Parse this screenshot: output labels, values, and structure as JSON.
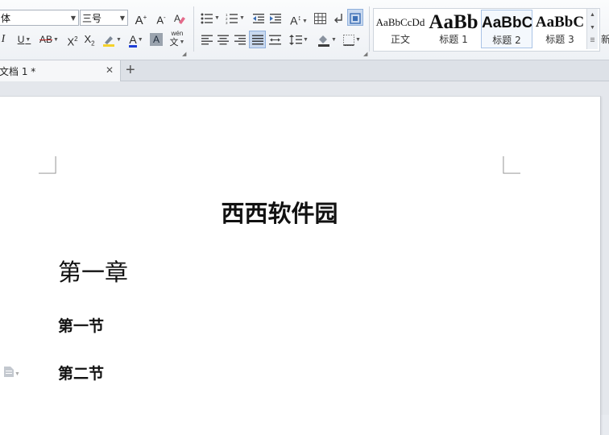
{
  "toolbar": {
    "font_name": "体",
    "font_size": "三号",
    "grow_font": "A",
    "shrink_font": "A",
    "italic": "I",
    "underline": "U",
    "strike": "AB",
    "superscript": "X",
    "subscript": "X",
    "font_color": "A",
    "char_shading": "A",
    "phonetic_top": "wén",
    "phonetic_bottom": "文",
    "text_direction": "A"
  },
  "styles": {
    "items": [
      {
        "name": "正文",
        "sample": "AaBbCcDd"
      },
      {
        "name": "标题 1",
        "sample": "AaBb"
      },
      {
        "name": "标题 2",
        "sample": "AaBbC"
      },
      {
        "name": "标题 3",
        "sample": "AaBbC"
      }
    ],
    "new_style": "新"
  },
  "tabs": {
    "doc_title": "文档 1 *",
    "close": "✕",
    "new_tab": "+"
  },
  "document": {
    "title": "西西软件园",
    "chapter": "第一章",
    "section1": "第一节",
    "section2": "第二节"
  },
  "colors": {
    "accent": "#3c6fb5",
    "highlight": "#f5d22b",
    "font_color_bar": "#1f3fd6",
    "selected": "#c9d9ef"
  }
}
